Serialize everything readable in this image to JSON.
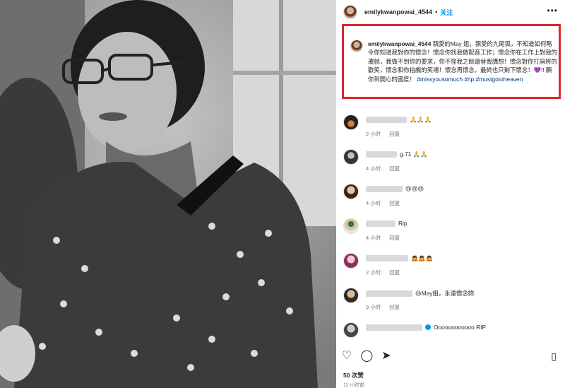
{
  "post": {
    "username": "emilykwanpowai_4544",
    "dot": "•",
    "follow_label": "关注",
    "more_label": "•••"
  },
  "caption": {
    "username": "emilykwanpowai_4544",
    "text": " 親愛的May 姐，親愛的九尾狐，不知道如何略令你知道我對你的懷念！懷念你找我做配音工作；懷念你在工作上對我的遷就，我做不到你的要求，你不怪我之餘還替我講想！懷念對你打麻將的歡笑，懷念和你拍戲的笑場！懷念再懷念，最終也只剩下懷念！",
    "emoji": "💜",
    "text2": "!! 願你到開心的國度！",
    "tags": "#missyousomuch #rip #mustgotoheaven"
  },
  "comments": [
    {
      "name_width": 58,
      "text": "🙏🙏🙏",
      "time": "2 小时",
      "reply": "回复"
    },
    {
      "name_width": 44,
      "text": "g.71 🙏🙏",
      "time": "4 小时",
      "reply": "回复"
    },
    {
      "name_width": 52,
      "text": "😢😢😢",
      "time": "4 小时",
      "reply": "回复"
    },
    {
      "name_width": 42,
      "text": "Rip",
      "time": "4 小时",
      "reply": "回复"
    },
    {
      "name_width": 60,
      "text": "🙇🙇🙇",
      "time": "2 小时",
      "reply": "回复"
    },
    {
      "name_width": 66,
      "text": "😢May姐，永遠懷念妳.",
      "time": "9 小时",
      "reply": "回复"
    },
    {
      "name_width": 80,
      "text": "Oooooooooooo RIP",
      "time": "3 小时",
      "reply": "回复"
    }
  ],
  "actions": {
    "like_icon": "heart-icon",
    "comment_icon": "comment-icon",
    "share_icon": "share-icon",
    "save_icon": "bookmark-icon"
  },
  "likes": "50 次赞",
  "timestamp": "11 小时前"
}
